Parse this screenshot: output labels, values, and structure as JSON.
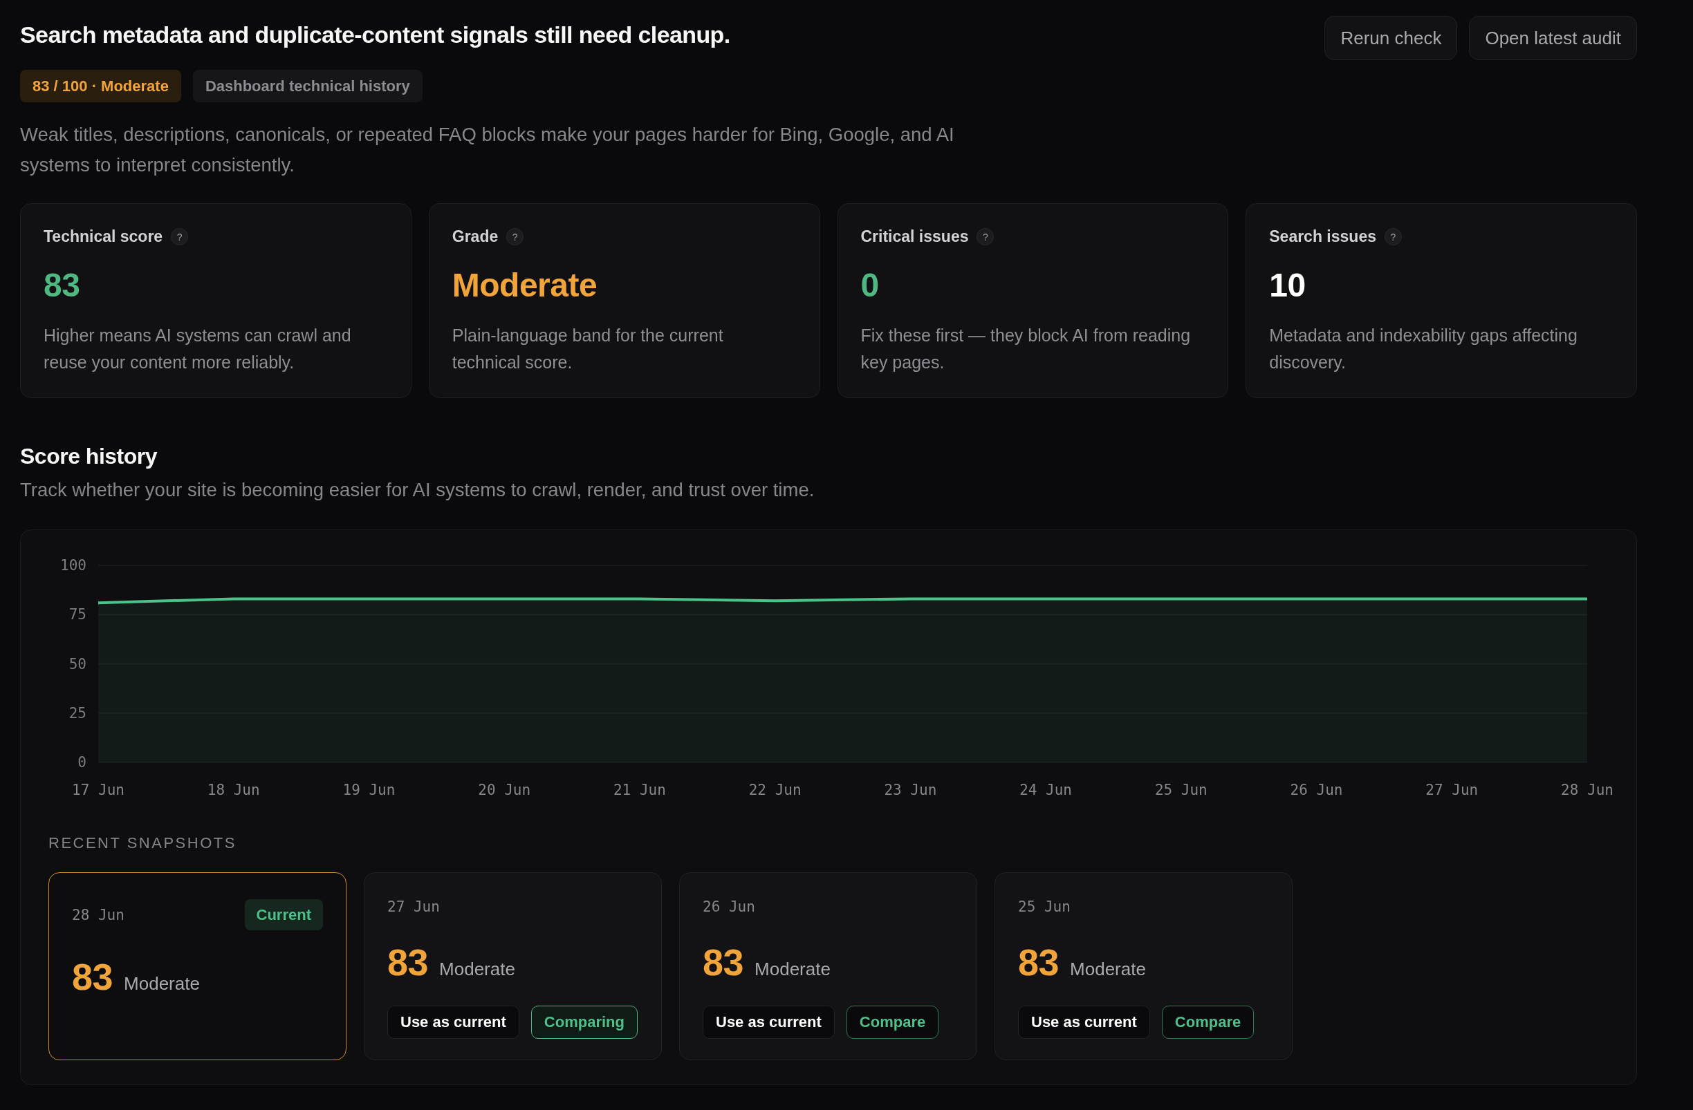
{
  "header": {
    "title": "Search metadata and duplicate-content signals still need cleanup.",
    "actions": [
      {
        "label": "Rerun check"
      },
      {
        "label": "Open latest audit"
      }
    ],
    "badges": [
      {
        "label": "83 / 100 · Moderate",
        "kind": "score"
      },
      {
        "label": "Dashboard technical history",
        "kind": "source"
      }
    ],
    "description": "Weak titles, descriptions, canonicals, or repeated FAQ blocks make your pages harder for Bing, Google, and AI systems to interpret consistently."
  },
  "metrics": [
    {
      "label": "Technical score",
      "help": "?",
      "value": "83",
      "color": "#4fb882",
      "description": "Higher means AI systems can crawl and reuse your content more reliably."
    },
    {
      "label": "Grade",
      "help": "?",
      "value": "Moderate",
      "color": "#f0a43a",
      "description": "Plain-language band for the current technical score."
    },
    {
      "label": "Critical issues",
      "help": "?",
      "value": "0",
      "color": "#4fb882",
      "description": "Fix these first — they block AI from reading key pages."
    },
    {
      "label": "Search issues",
      "help": "?",
      "value": "10",
      "color": "#ffffff",
      "description": "Metadata and indexability gaps affecting discovery."
    }
  ],
  "score_history": {
    "title": "Score history",
    "subtitle": "Track whether your site is becoming easier for AI systems to crawl, render, and trust over time.",
    "chart_data": {
      "type": "area",
      "x": [
        "17 Jun",
        "18 Jun",
        "19 Jun",
        "20 Jun",
        "21 Jun",
        "22 Jun",
        "23 Jun",
        "24 Jun",
        "25 Jun",
        "26 Jun",
        "27 Jun",
        "28 Jun"
      ],
      "series": [
        {
          "color": "#4cc38a",
          "values": [
            81,
            83,
            83,
            83,
            83,
            82,
            83,
            83,
            83,
            83,
            83,
            83
          ]
        }
      ],
      "ylim": [
        0,
        100
      ],
      "yticks": [
        0,
        25,
        50,
        75,
        100
      ],
      "grid": true
    },
    "snapshots_heading": "RECENT SNAPSHOTS",
    "snapshots": [
      {
        "date": "28 Jun",
        "score": "83",
        "grade": "Moderate",
        "current": true,
        "badge": "Current"
      },
      {
        "date": "27 Jun",
        "score": "83",
        "grade": "Moderate",
        "current": false,
        "use_button": {
          "label": "Use as current"
        },
        "compare_button": {
          "label": "Comparing",
          "selected": true
        }
      },
      {
        "date": "26 Jun",
        "score": "83",
        "grade": "Moderate",
        "current": false,
        "use_button": {
          "label": "Use as current"
        },
        "compare_button": {
          "label": "Compare",
          "selected": false
        }
      },
      {
        "date": "25 Jun",
        "score": "83",
        "grade": "Moderate",
        "current": false,
        "use_button": {
          "label": "Use as current"
        },
        "compare_button": {
          "label": "Compare",
          "selected": false
        }
      }
    ]
  }
}
